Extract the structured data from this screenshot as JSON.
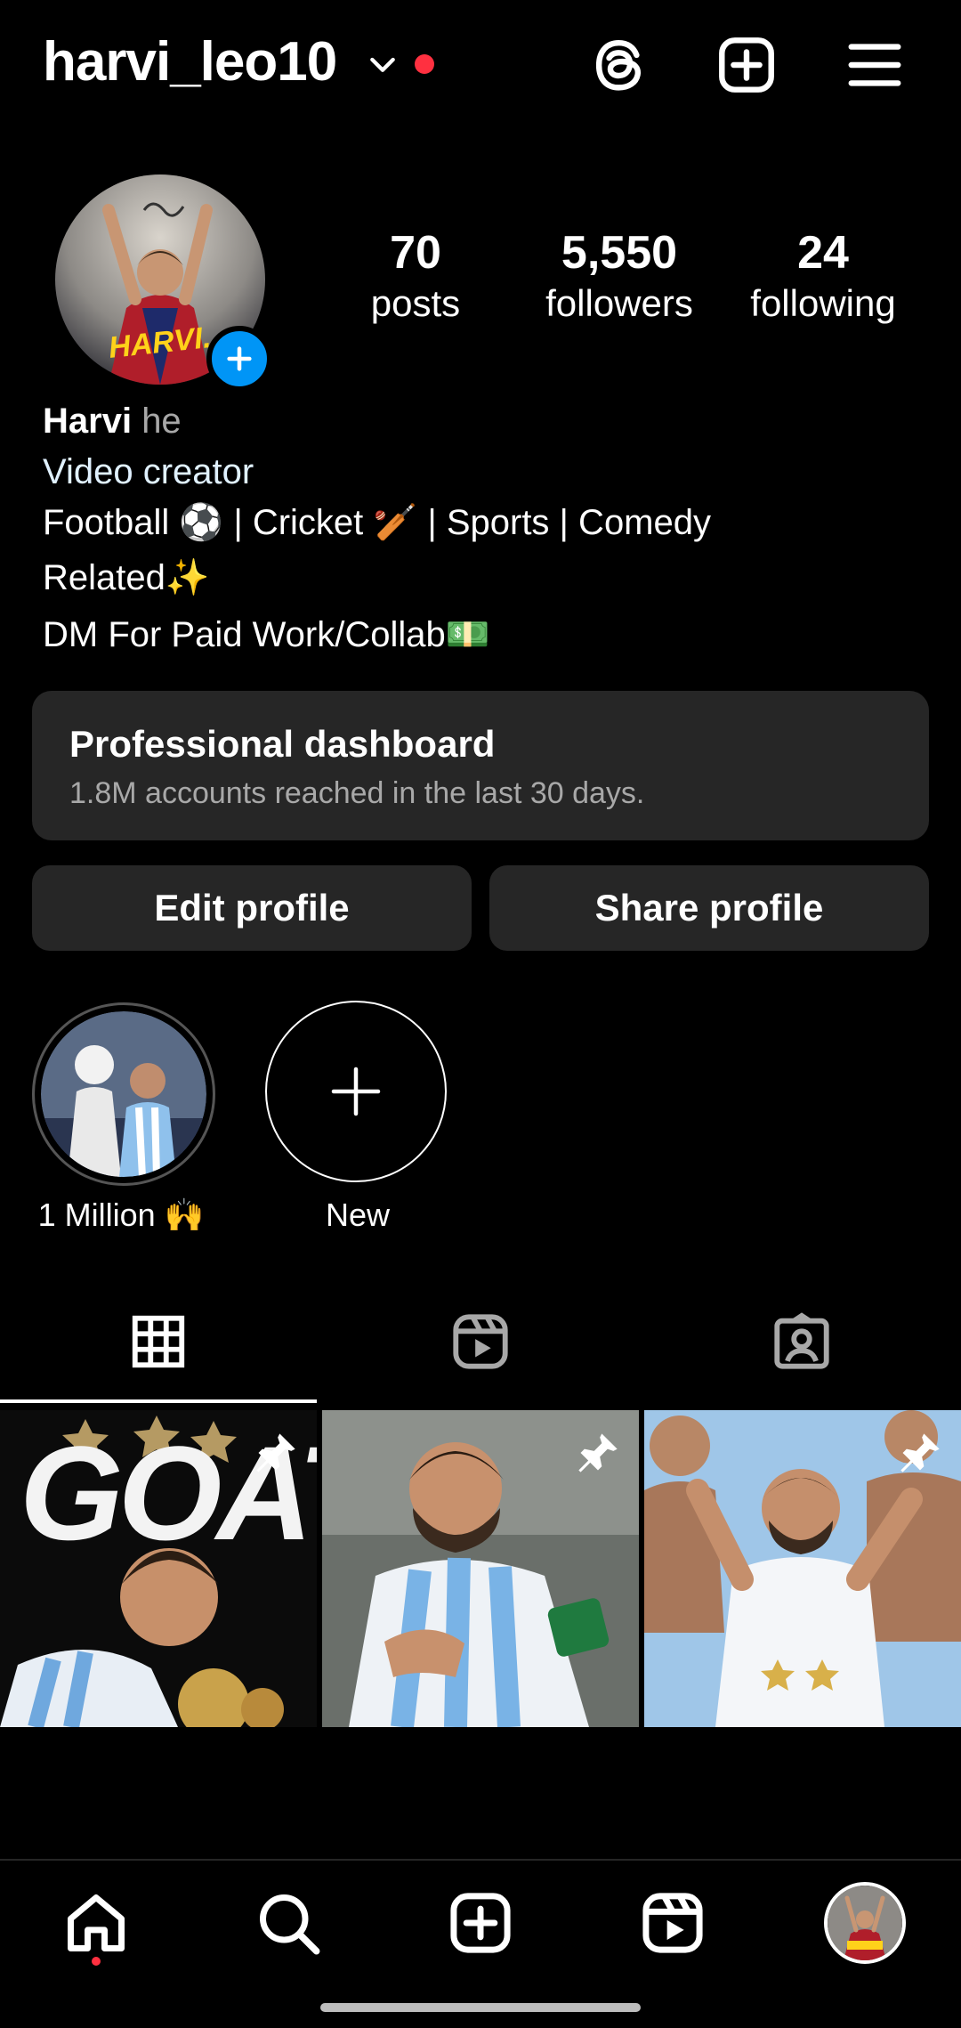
{
  "header": {
    "username": "harvi_leo10"
  },
  "profile": {
    "stats": [
      {
        "value": "70",
        "label": "posts"
      },
      {
        "value": "5,550",
        "label": "followers"
      },
      {
        "value": "24",
        "label": "following"
      }
    ],
    "name": "Harvi",
    "pronouns": "he",
    "category": "Video creator",
    "bio_lines": [
      "Football ⚽ | Cricket 🏏 | Sports | Comedy",
      "Related✨",
      "DM For Paid Work/Collab💵"
    ],
    "avatar_text": "HARVI."
  },
  "dashboard": {
    "title": "Professional dashboard",
    "subtitle": "1.8M accounts reached in the last 30 days."
  },
  "buttons": {
    "edit": "Edit profile",
    "share": "Share profile"
  },
  "highlights": [
    {
      "label": "1 Million 🙌"
    },
    {
      "label": "New"
    }
  ],
  "posts": [
    {
      "overlay_text": "GOAT",
      "pinned": true
    },
    {
      "overlay_text": "",
      "pinned": true
    },
    {
      "overlay_text": "",
      "pinned": true
    }
  ],
  "colors": {
    "accent_blue": "#0095f6",
    "notification_red": "#ff3040",
    "card_bg": "#262626"
  }
}
